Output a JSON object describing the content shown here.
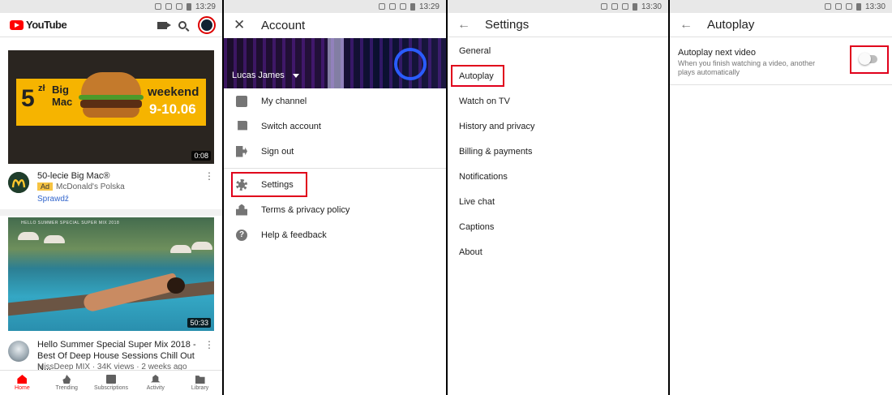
{
  "status_times": [
    "13:29",
    "13:29",
    "13:30",
    "13:30"
  ],
  "panel1": {
    "logo_text": "YouTube",
    "videos": [
      {
        "duration": "0:08",
        "title": "50-lecie Big Mac®",
        "ad_badge": "Ad",
        "channel": "McDonald's Polska",
        "cta": "Sprawdź",
        "banner": {
          "five": "5",
          "zl": "zł",
          "big": "Big",
          "mac": "Mac",
          "weekend": "weekend",
          "dates": "9-10.06"
        }
      },
      {
        "duration": "50:33",
        "title": "Hello Summer Special Super Mix 2018 - Best Of Deep House Sessions Chill Out N...",
        "meta": "MissDeep MIX · 34K views · 2 weeks ago",
        "thumb_text": "HELLO SUMMER SPECIAL SUPER MIX 2018"
      }
    ],
    "nav": [
      {
        "label": "Home",
        "icon": "home-icon",
        "active": true
      },
      {
        "label": "Trending",
        "icon": "trending-icon"
      },
      {
        "label": "Subscriptions",
        "icon": "subscriptions-icon"
      },
      {
        "label": "Activity",
        "icon": "activity-icon"
      },
      {
        "label": "Library",
        "icon": "library-icon"
      }
    ]
  },
  "panel2": {
    "title": "Account",
    "account_name": "Lucas James",
    "menu": [
      {
        "label": "My channel",
        "icon": "person-icon"
      },
      {
        "label": "Switch account",
        "icon": "switch-account-icon"
      },
      {
        "label": "Sign out",
        "icon": "sign-out-icon"
      },
      {
        "label": "Settings",
        "icon": "gear-icon"
      },
      {
        "label": "Terms & privacy policy",
        "icon": "lock-icon"
      },
      {
        "label": "Help & feedback",
        "icon": "help-icon",
        "glyph": "?"
      }
    ]
  },
  "panel3": {
    "title": "Settings",
    "items": [
      "General",
      "Autoplay",
      "Watch on TV",
      "History and privacy",
      "Billing & payments",
      "Notifications",
      "Live chat",
      "Captions",
      "About"
    ]
  },
  "panel4": {
    "title": "Autoplay",
    "setting_title": "Autoplay next video",
    "setting_desc": "When you finish watching a video, another plays automatically",
    "toggle_on": false
  },
  "colors": {
    "highlight": "#e0001b",
    "yt_red": "#ff0000",
    "link_blue": "#3366cc",
    "ad_yellow": "#f6c342"
  }
}
